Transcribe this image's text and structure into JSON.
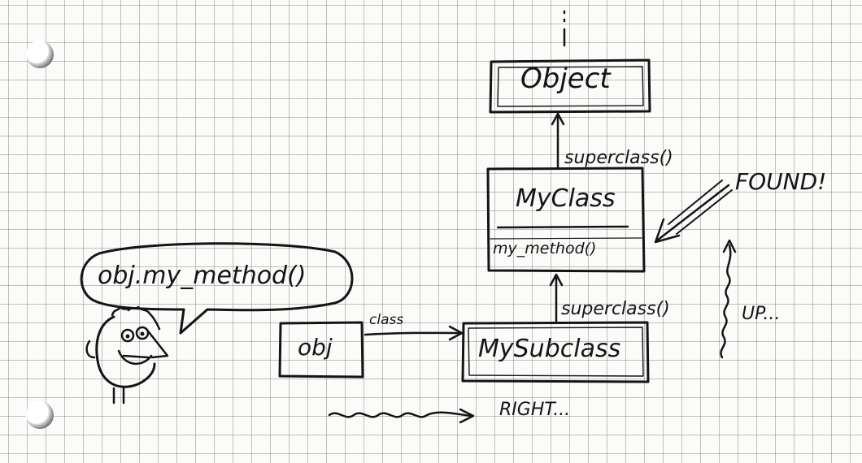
{
  "nodes": {
    "object": "Object",
    "myclass": "MyClass",
    "myclass_method": "my_method()",
    "mysubclass": "MySubclass",
    "obj": "obj"
  },
  "edges": {
    "obj_to_subclass": "class",
    "subclass_to_class": "superclass()",
    "class_to_object": "superclass()"
  },
  "annotations": {
    "speech": "obj.my_method()",
    "found": "FOUND!",
    "up": "UP...",
    "right": "RIGHT..."
  },
  "colors": {
    "ink": "#141414",
    "paper": "#fbfbfa",
    "grid": "#8a8a8a"
  },
  "icons": [
    "binder-hole",
    "stick-figure-face"
  ]
}
